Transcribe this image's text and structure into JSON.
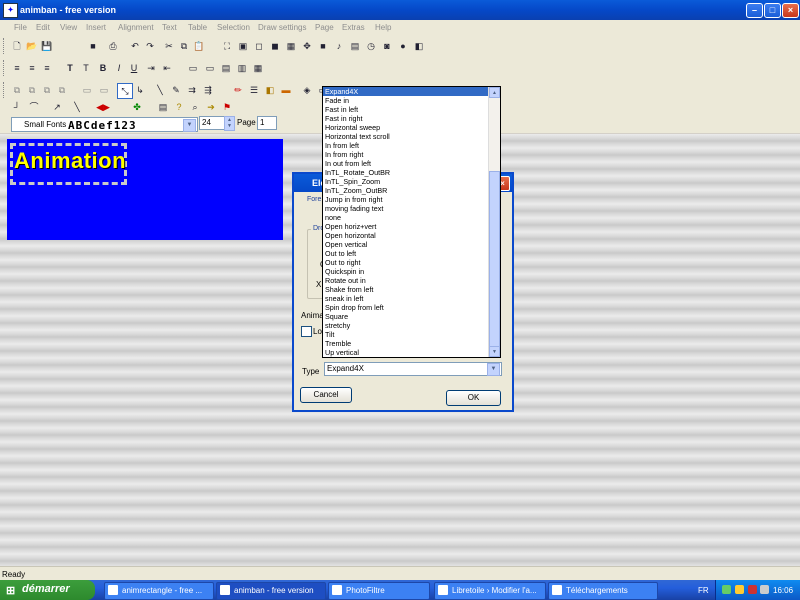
{
  "window": {
    "title": "animban - free version",
    "icon": "app-icon",
    "controls": [
      "minimize-icon",
      "maximize-icon",
      "close-icon"
    ]
  },
  "menu": [
    "File",
    "Edit",
    "View",
    "Insert",
    "Alignment",
    "Text",
    "Table",
    "Selection",
    "Draw settings",
    "Page",
    "Extras",
    "Help"
  ],
  "format_bar": {
    "font_name": "Small Fonts",
    "font_preview": "ABCdef123",
    "font_size": "24",
    "page_label": "Page",
    "page_value": "1"
  },
  "canvas": {
    "text": "Animation",
    "background_color": "#0000ff",
    "text_color": "#ffff00"
  },
  "dialog": {
    "title": "Ele",
    "tab_label": "Fore",
    "group_label": "Dro",
    "partial_letters": [
      "Q",
      "X"
    ],
    "animation_label": "Animat",
    "lock_label": "Loc",
    "type_label": "Type",
    "type_value": "Expand4X",
    "cancel_label": "Cancel",
    "ok_label": "OK"
  },
  "type_options": [
    "Expand4X",
    "Fade in",
    "Fast in left",
    "Fast in right",
    "Horizontal sweep",
    "Horizontal text scroll",
    "In from left",
    "In from right",
    "In out from left",
    "InTL_Rotate_OutBR",
    "InTL_Spin_Zoom",
    "InTL_Zoom_OutBR",
    "Jump in from right",
    "moving fading text",
    "none",
    "Open horiz+vert",
    "Open horizontal",
    "Open vertical",
    "Out to left",
    "Out to right",
    "Quickspin in",
    "Rotate out in",
    "Shake from left",
    "sneak in left",
    "Spin drop from left",
    "Square",
    "stretchy",
    "Tilt",
    "Tremble",
    "Up vertical"
  ],
  "selected_option": "Expand4X",
  "status": "Ready",
  "taskbar": {
    "start_label": "démarrer",
    "buttons": [
      {
        "label": "animrectangle - free ..."
      },
      {
        "label": "animban - free version",
        "active": true
      },
      {
        "label": "PhotoFiltre"
      },
      {
        "label": "Libretoile › Modifier l'a..."
      },
      {
        "label": "Téléchargements"
      }
    ],
    "language": "FR",
    "clock": "16:06"
  },
  "colors": {
    "accent_blue": "#0a5bd9",
    "selection": "#316ac5",
    "start_green": "#3c9e3c"
  }
}
